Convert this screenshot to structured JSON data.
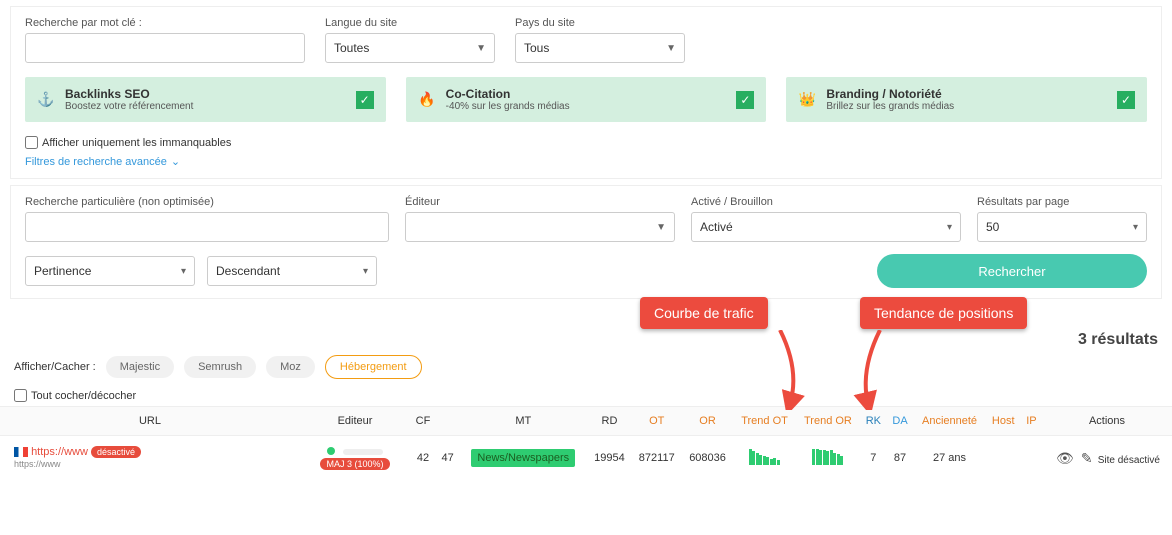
{
  "topFilters": {
    "keywordLabel": "Recherche par mot clé :",
    "langLabel": "Langue du site",
    "langValue": "Toutes",
    "countryLabel": "Pays du site",
    "countryValue": "Tous"
  },
  "tiles": [
    {
      "icon": "⚓",
      "title": "Backlinks SEO",
      "sub": "Boostez votre référencement",
      "checked": true
    },
    {
      "icon": "🔥",
      "title": "Co-Citation",
      "sub": "-40% sur les grands médias",
      "checked": true
    },
    {
      "icon": "👑",
      "title": "Branding / Notoriété",
      "sub": "Brillez sur les grands médias",
      "checked": true
    }
  ],
  "advanced": {
    "onlyMustLabel": "Afficher uniquement les immanquables",
    "advLink": "Filtres de recherche avancée"
  },
  "searchRow": {
    "particularLabel": "Recherche particulière (non optimisée)",
    "editorLabel": "Éditeur",
    "statusLabel": "Activé / Brouillon",
    "statusValue": "Activé",
    "perPageLabel": "Résultats par page",
    "perPageValue": "50",
    "sortField": "Pertinence",
    "sortDir": "Descendant",
    "searchBtn": "Rechercher"
  },
  "callouts": {
    "traffic": "Courbe de trafic",
    "positions": "Tendance de positions"
  },
  "resultsCount": "3 résultats",
  "pillsLabel": "Afficher/Cacher :",
  "pills": [
    "Majestic",
    "Semrush",
    "Moz",
    "Hébergement"
  ],
  "checkAll": "Tout cocher/décocher",
  "headers": {
    "url": "URL",
    "editor": "Editeur",
    "cf": "CF",
    "tf": "",
    "mt": "MT",
    "rd": "RD",
    "ot": "OT",
    "or": "OR",
    "trendOt": "Trend OT",
    "trendOr": "Trend OR",
    "rk": "RK",
    "da": "DA",
    "anc": "Ancienneté",
    "host": "Host",
    "ip": "IP",
    "actions": "Actions"
  },
  "rows": [
    {
      "flag": "fr",
      "url": "https://www",
      "subUrl": "https://www",
      "badgeDeact": "désactivé",
      "maj": "MAJ 3 (100%)",
      "cf": "42",
      "tf": "47",
      "mt": "News/Newspapers",
      "rd": "19954",
      "ot": "872117",
      "or": "608036",
      "rk": "7",
      "da": "87",
      "anc": "27 ans",
      "actionText": "Site désactivé"
    }
  ]
}
